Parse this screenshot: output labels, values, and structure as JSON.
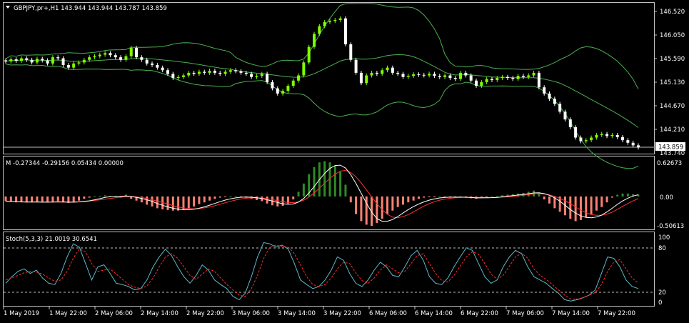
{
  "main": {
    "title": "GBPJPY,pr+,H1  143.944 143.944 143.787 143.859",
    "price_ticks": [
      "146.520",
      "146.050",
      "145.590",
      "145.130",
      "144.670",
      "144.210",
      "143.740"
    ],
    "current_price_label": "143.859"
  },
  "macd": {
    "title": "M -0.27344 -0.29156 0.05434 0.00000",
    "ticks": [
      "0.62673",
      "0.00",
      "-0.50613"
    ]
  },
  "stoch": {
    "title": "Stoch(5,3,3) 21.0019 30.6541",
    "ticks": [
      "100",
      "80",
      "20",
      "0"
    ]
  },
  "time_axis": [
    "1 May 2019",
    "1 May 22:00",
    "2 May 06:00",
    "2 May 14:00",
    "2 May 22:00",
    "3 May 06:00",
    "3 May 14:00",
    "3 May 22:00",
    "6 May 06:00",
    "6 May 14:00",
    "6 May 22:00",
    "7 May 06:00",
    "7 May 14:00",
    "7 May 22:00"
  ],
  "chart_data": [
    {
      "type": "candlestick",
      "title": "GBPJPY,pr+,H1  143.944 143.944 143.787 143.859",
      "ylim": [
        143.74,
        146.65
      ],
      "y_ticks": [
        146.52,
        146.05,
        145.59,
        145.13,
        144.67,
        144.21,
        143.74
      ],
      "x_ticks": [
        "1 May 2019",
        "1 May 22:00",
        "2 May 06:00",
        "2 May 14:00",
        "2 May 22:00",
        "3 May 06:00",
        "3 May 14:00",
        "3 May 22:00",
        "6 May 06:00",
        "6 May 14:00",
        "6 May 22:00",
        "7 May 06:00",
        "7 May 14:00",
        "7 May 22:00"
      ],
      "close_series": [
        145.52,
        145.56,
        145.53,
        145.58,
        145.55,
        145.5,
        145.57,
        145.54,
        145.48,
        145.6,
        145.58,
        145.45,
        145.4,
        145.48,
        145.5,
        145.55,
        145.6,
        145.62,
        145.65,
        145.68,
        145.64,
        145.6,
        145.55,
        145.62,
        145.78,
        145.6,
        145.55,
        145.48,
        145.45,
        145.4,
        145.35,
        145.28,
        145.2,
        145.22,
        145.25,
        145.3,
        145.28,
        145.32,
        145.3,
        145.34,
        145.3,
        145.28,
        145.32,
        145.35,
        145.33,
        145.3,
        145.28,
        145.22,
        145.24,
        145.28,
        145.12,
        145.0,
        144.9,
        144.95,
        145.05,
        145.15,
        145.25,
        145.5,
        145.8,
        146.05,
        146.2,
        146.28,
        146.3,
        146.32,
        146.35,
        145.85,
        145.55,
        145.3,
        145.1,
        145.25,
        145.3,
        145.28,
        145.35,
        145.4,
        145.3,
        145.28,
        145.22,
        145.24,
        145.27,
        145.26,
        145.25,
        145.28,
        145.24,
        145.22,
        145.25,
        145.2,
        145.18,
        145.3,
        145.25,
        145.15,
        145.05,
        145.12,
        145.18,
        145.16,
        145.2,
        145.22,
        145.2,
        145.18,
        145.24,
        145.22,
        145.25,
        145.3,
        145.02,
        144.9,
        144.8,
        144.7,
        144.55,
        144.4,
        144.25,
        144.05,
        143.98,
        144.0,
        144.05,
        144.1,
        144.12,
        144.08,
        144.1,
        144.06,
        144.0,
        143.95,
        143.9,
        143.86
      ],
      "series": [
        {
          "name": "Upper Band",
          "color": "#4caf50"
        },
        {
          "name": "Middle Band",
          "color": "#4caf50"
        },
        {
          "name": "Lower Band",
          "color": "#4caf50"
        }
      ],
      "up_color": "#7fff00",
      "down_color": "#ffffff"
    },
    {
      "type": "bar",
      "title": "M -0.27344 -0.29156 0.05434 0.00000",
      "ylim": [
        -0.56,
        0.68
      ],
      "y_ticks": [
        0.62673,
        0.0,
        -0.50613
      ],
      "values": [
        -0.08,
        -0.09,
        -0.1,
        -0.1,
        -0.1,
        -0.09,
        -0.09,
        -0.1,
        -0.1,
        -0.09,
        -0.08,
        -0.1,
        -0.11,
        -0.1,
        -0.07,
        -0.04,
        -0.02,
        0.0,
        0.01,
        0.02,
        0.01,
        0.0,
        -0.02,
        0.03,
        -0.04,
        -0.07,
        -0.1,
        -0.14,
        -0.17,
        -0.2,
        -0.22,
        -0.23,
        -0.24,
        -0.24,
        -0.22,
        -0.2,
        -0.17,
        -0.13,
        -0.1,
        -0.07,
        -0.04,
        -0.02,
        -0.01,
        0.0,
        0.0,
        -0.01,
        -0.02,
        -0.04,
        -0.06,
        -0.08,
        -0.12,
        -0.15,
        -0.17,
        -0.16,
        -0.12,
        -0.05,
        0.08,
        0.22,
        0.38,
        0.5,
        0.58,
        0.6,
        0.58,
        0.52,
        0.42,
        0.2,
        -0.1,
        -0.3,
        -0.42,
        -0.48,
        -0.5,
        -0.45,
        -0.38,
        -0.3,
        -0.24,
        -0.18,
        -0.14,
        -0.1,
        -0.07,
        -0.04,
        -0.02,
        -0.01,
        -0.01,
        0.0,
        -0.01,
        -0.02,
        -0.02,
        -0.01,
        -0.02,
        -0.03,
        -0.04,
        -0.02,
        -0.01,
        0.0,
        0.01,
        0.02,
        0.03,
        0.04,
        0.05,
        0.06,
        0.08,
        0.1,
        0.05,
        -0.05,
        -0.12,
        -0.2,
        -0.26,
        -0.32,
        -0.38,
        -0.42,
        -0.4,
        -0.36,
        -0.3,
        -0.24,
        -0.18,
        -0.1,
        -0.02,
        0.03,
        0.05,
        0.05,
        0.04,
        0.03
      ],
      "series": [
        {
          "name": "Signal",
          "color": "#ff3030"
        },
        {
          "name": "MACD line",
          "color": "#ffffff"
        }
      ],
      "positive_color": "#2e8b22",
      "negative_color": "#fa8072"
    },
    {
      "type": "line",
      "title": "Stoch(5,3,3) 21.0019 30.6541",
      "ylim": [
        0,
        100
      ],
      "y_ticks": [
        100,
        80,
        20,
        0
      ],
      "levels": [
        80,
        20
      ],
      "main_values": [
        30,
        40,
        48,
        52,
        45,
        50,
        38,
        30,
        28,
        45,
        70,
        90,
        85,
        60,
        35,
        55,
        58,
        45,
        30,
        28,
        25,
        20,
        22,
        35,
        55,
        70,
        82,
        72,
        55,
        40,
        30,
        42,
        58,
        50,
        35,
        28,
        22,
        10,
        5,
        15,
        40,
        70,
        92,
        90,
        85,
        88,
        82,
        60,
        35,
        28,
        22,
        25,
        35,
        50,
        70,
        65,
        45,
        30,
        25,
        35,
        50,
        62,
        55,
        42,
        40,
        55,
        72,
        80,
        65,
        40,
        30,
        28,
        38,
        55,
        70,
        84,
        80,
        60,
        40,
        30,
        35,
        55,
        70,
        80,
        75,
        55,
        40,
        35,
        30,
        22,
        15,
        5,
        3,
        5,
        8,
        12,
        20,
        45,
        70,
        68,
        55,
        35,
        25,
        22
      ],
      "signal_values": [
        35,
        38,
        42,
        46,
        48,
        47,
        44,
        38,
        33,
        35,
        48,
        68,
        82,
        78,
        60,
        48,
        50,
        52,
        44,
        36,
        28,
        24,
        22,
        26,
        38,
        55,
        70,
        75,
        68,
        55,
        42,
        36,
        44,
        52,
        48,
        38,
        28,
        20,
        12,
        10,
        22,
        42,
        68,
        85,
        88,
        86,
        85,
        75,
        58,
        40,
        28,
        25,
        28,
        38,
        52,
        62,
        60,
        46,
        34,
        30,
        38,
        50,
        58,
        52,
        46,
        48,
        60,
        72,
        75,
        60,
        45,
        34,
        32,
        42,
        56,
        70,
        78,
        74,
        60,
        44,
        36,
        42,
        56,
        70,
        76,
        68,
        52,
        42,
        36,
        28,
        20,
        12,
        6,
        6,
        8,
        12,
        16,
        28,
        48,
        62,
        66,
        52,
        38,
        30
      ],
      "series": [
        {
          "name": "Main",
          "color": "#5fb7c9"
        },
        {
          "name": "Signal",
          "color": "#ff2a2a"
        }
      ]
    }
  ]
}
